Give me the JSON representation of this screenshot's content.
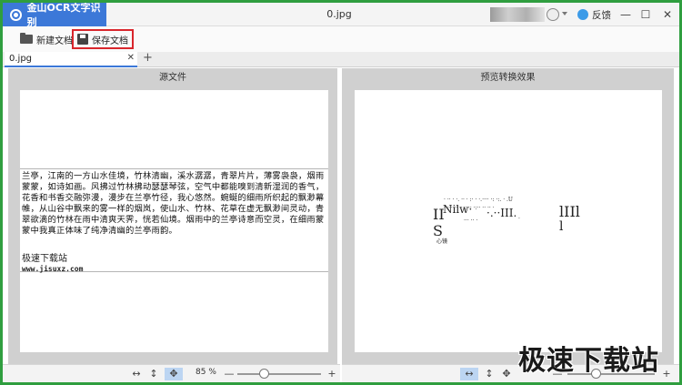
{
  "app": {
    "title": "金山OCR文字识别",
    "document_title": "0.jpg"
  },
  "header": {
    "feedback_label": "反馈",
    "min": "—",
    "max": "☐",
    "close": "✕"
  },
  "toolbar": {
    "new_label": "新建文档",
    "save_label": "保存文档"
  },
  "tabs": [
    {
      "label": "0.jpg",
      "close": "✕"
    }
  ],
  "add_tab": "+",
  "panels": {
    "source": {
      "title": "源文件",
      "ocr_text": "兰亭，江南的一方山水佳境，竹林清幽，溪水潺潺，青翠片片，薄雾袅袅，烟雨蒙蒙，如诗如画。风拂过竹林拂动瑟瑟琴弦，空气中都能嗅到清新湿润的香气，花香和书香交融弥漫，漫步在兰亭竹径，我心悠然。蜿蜒的细雨所织起的飘渺幕帷，从山谷中飘来的雾一样的烟岚，使山水、竹林、花草在虚无飘渺间灵动，青翠欲滴的竹林在雨中清爽天霁，恍若仙境。烟雨中的兰亭诗意而空灵，在细雨蒙蒙中我真正体味了纯净清幽的兰亭雨韵。",
      "brand": "极速下载站",
      "url": "www.jisuxz.com"
    },
    "preview": {
      "title": "预览转换效果",
      "line1": "· ·· · ·. ·· · :· · ·.···· ·: ·:. · .U",
      "line2": "· :·· ·· ·  ·: ·· ·:·· ·· ·· ·",
      "frag_a": "II",
      "frag_b": "Nilw·",
      "frag_c": "·.··III.",
      "frag_d": "lIIl",
      "frag_e": "S",
      "frag_f": "l",
      "frag_g": "心镜",
      "frag_h": "·",
      "frag_i": "··· ·· ·"
    }
  },
  "bottombar": {
    "left": {
      "fit_width": "↔",
      "fit_height": "↕",
      "pan": "✥",
      "zoom": "85 %",
      "minus": "—",
      "plus": "+"
    },
    "right": {
      "fit_width": "↔",
      "fit_height": "↕",
      "pan": "✥",
      "minus": "—",
      "plus": "+"
    }
  },
  "zoom": {
    "left_level": 0.32,
    "right_level": 0.32
  },
  "watermark": "极速下载站",
  "colors": {
    "brand": "#3c78d8",
    "highlight": "#d9262c",
    "frame": "#2f9e3f"
  }
}
